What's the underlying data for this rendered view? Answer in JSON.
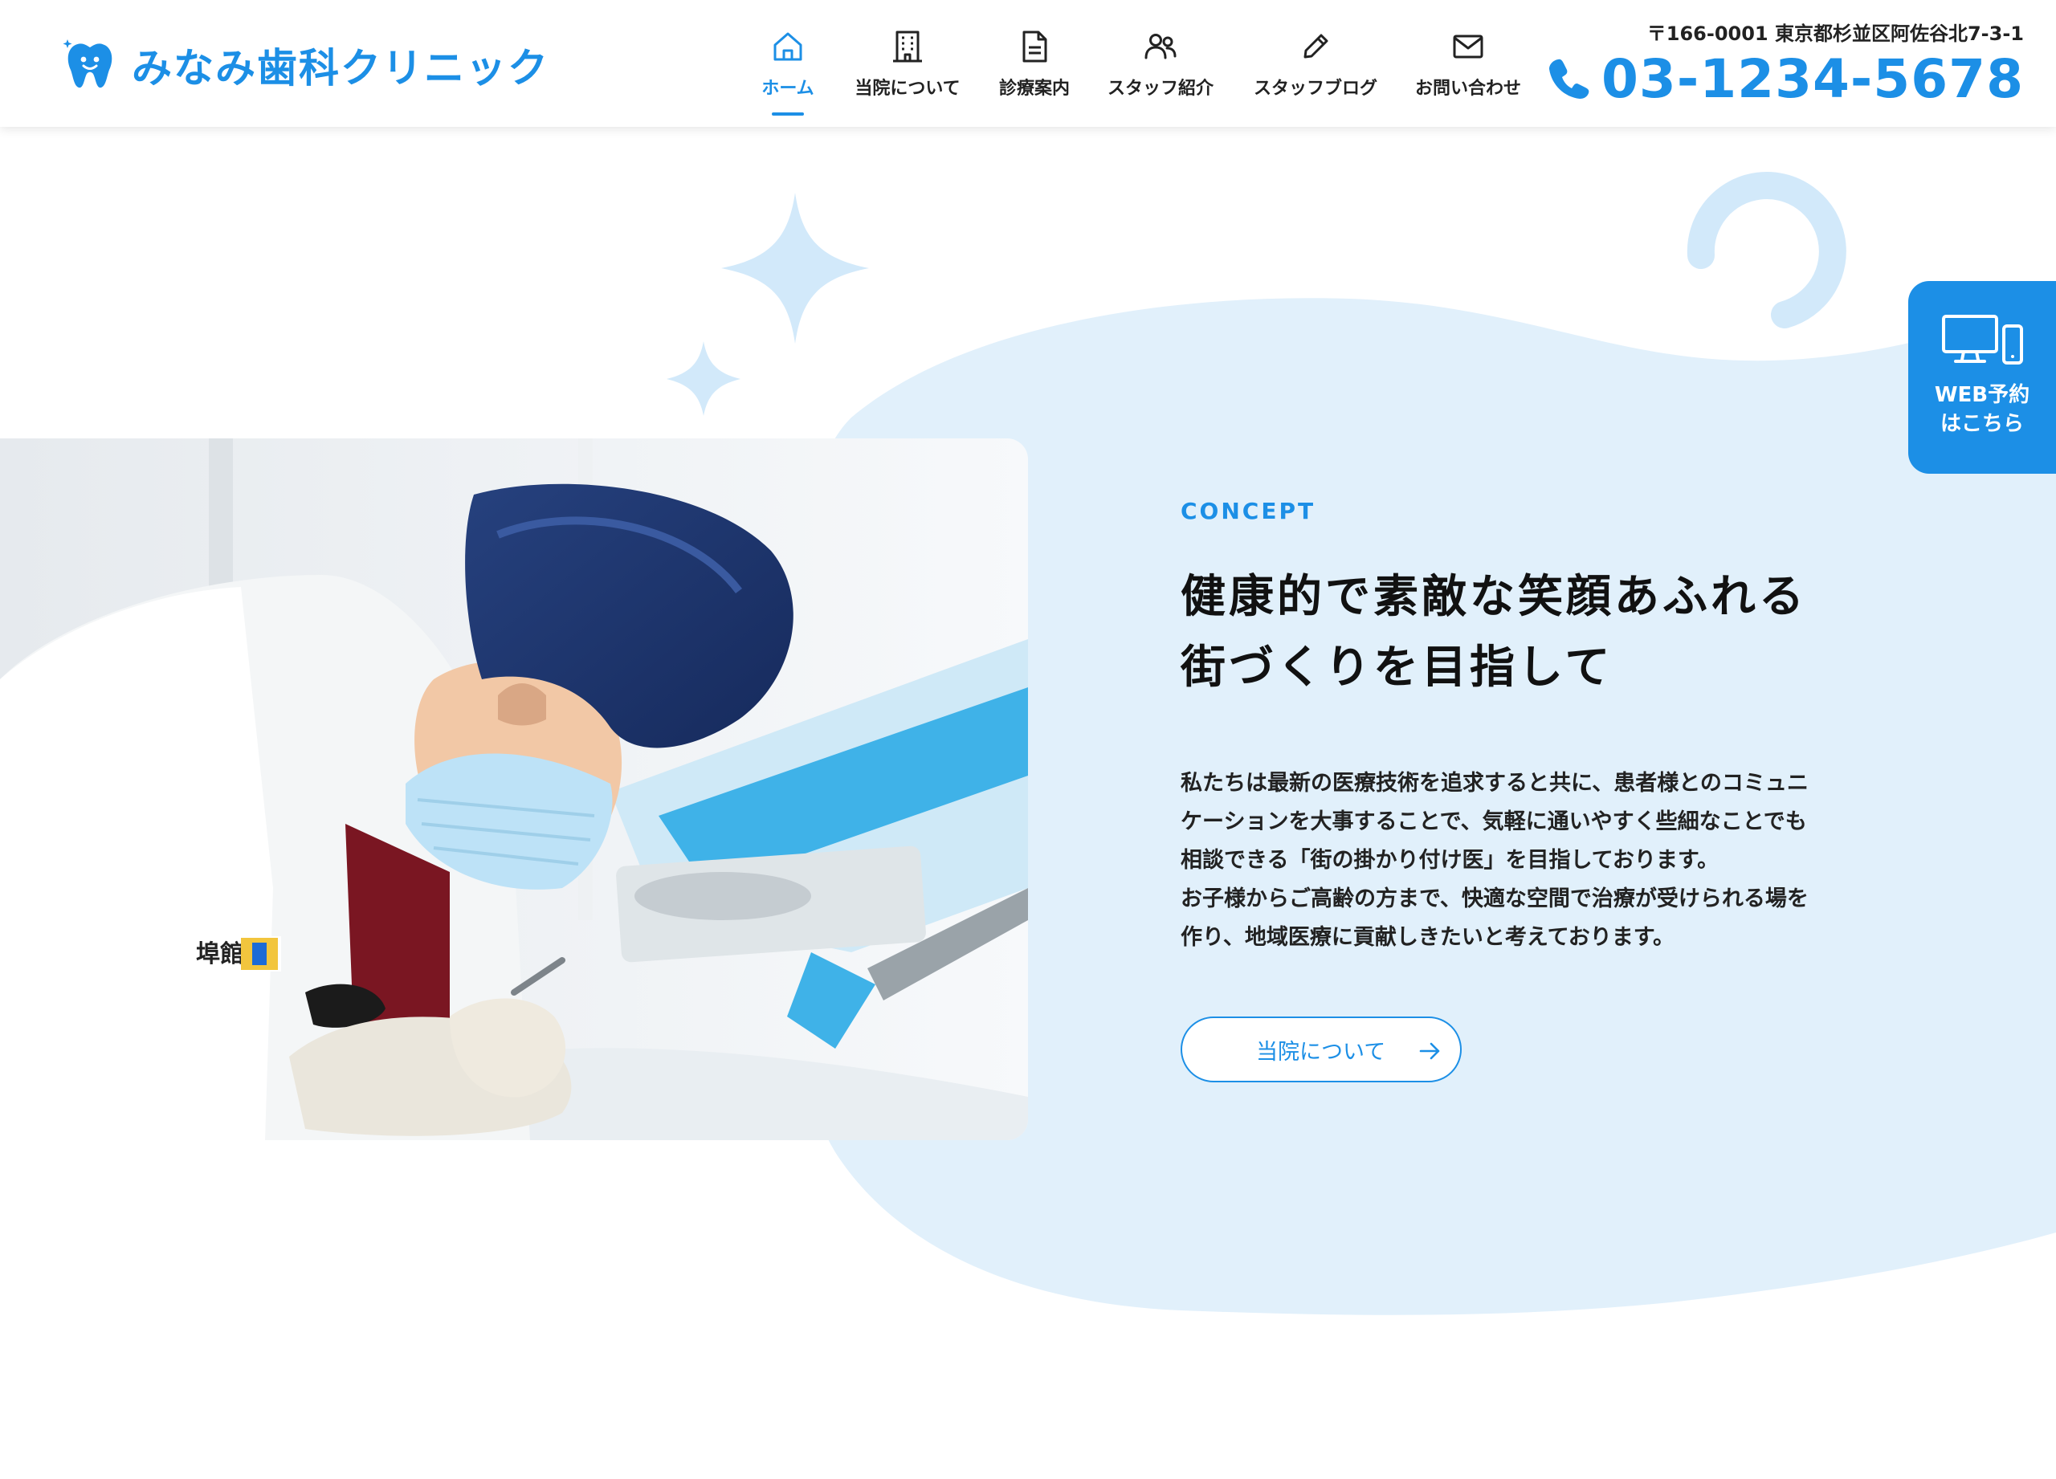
{
  "brand": {
    "clinic_name": "みなみ歯科クリニック",
    "logo_icon": "tooth-icon",
    "accent_color": "#1c8fe6"
  },
  "nav": {
    "items": [
      {
        "label": "ホーム",
        "icon": "home-icon",
        "active": true
      },
      {
        "label": "当院について",
        "icon": "building-icon",
        "active": false
      },
      {
        "label": "診療案内",
        "icon": "document-icon",
        "active": false
      },
      {
        "label": "スタッフ紹介",
        "icon": "people-icon",
        "active": false
      },
      {
        "label": "スタッフブログ",
        "icon": "pencil-icon",
        "active": false
      },
      {
        "label": "お問い合わせ",
        "icon": "mail-icon",
        "active": false
      }
    ]
  },
  "contact": {
    "address": "〒166-0001 東京都杉並区阿佐谷北7-3-1",
    "phone": "03-1234-5678",
    "phone_icon": "phone-icon"
  },
  "reserve": {
    "line1": "WEB予約",
    "line2": "はこちら",
    "icon": "devices-icon"
  },
  "concept": {
    "label": "CONCEPT",
    "title_line1": "健康的で素敵な笑顔あふれる",
    "title_line2": "街づくりを目指して",
    "body_lines": [
      "私たちは最新の医療技術を追求すると共に、患者様とのコミュニ",
      "ケーションを大事することで、気軽に通いやすく些細なことでも",
      "相談できる「街の掛かり付け医」を目指しております。",
      "お子様からご高齢の方まで、快適な空間で治療が受けられる場を",
      "作り、地域医療に貢献しきたいと考えております。"
    ],
    "button_label": "当院について",
    "button_icon": "arrow-right-icon"
  },
  "photo": {
    "subject": "dentist-at-work-photo",
    "badge_text": "埠館"
  }
}
